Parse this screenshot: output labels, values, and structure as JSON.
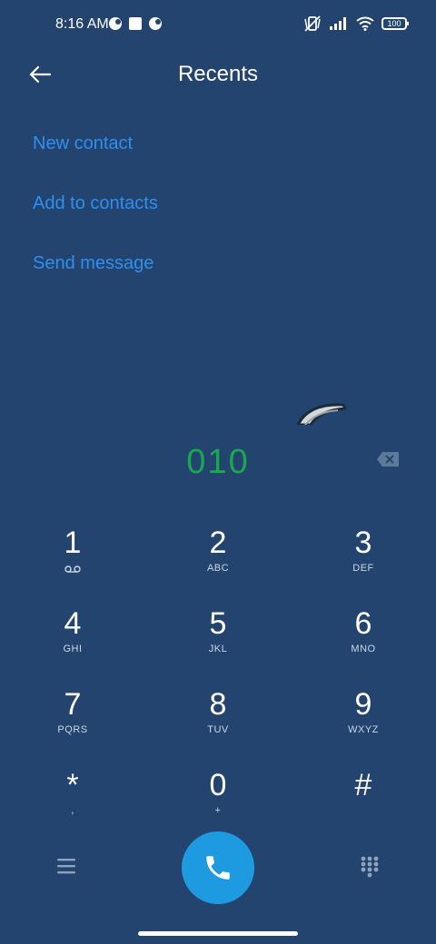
{
  "status_bar": {
    "time": "8:16 AM",
    "battery": "100"
  },
  "header": {
    "title": "Recents",
    "back_icon": "arrow-left-icon"
  },
  "actions": [
    {
      "label": "New contact"
    },
    {
      "label": "Add to contacts"
    },
    {
      "label": "Send message"
    }
  ],
  "dialer": {
    "number": "010",
    "number_color": "#18a84e"
  },
  "keypad": [
    {
      "digit": "1",
      "letters": ""
    },
    {
      "digit": "2",
      "letters": "ABC"
    },
    {
      "digit": "3",
      "letters": "DEF"
    },
    {
      "digit": "4",
      "letters": "GHI"
    },
    {
      "digit": "5",
      "letters": "JKL"
    },
    {
      "digit": "6",
      "letters": "MNO"
    },
    {
      "digit": "7",
      "letters": "PQRS"
    },
    {
      "digit": "8",
      "letters": "TUV"
    },
    {
      "digit": "9",
      "letters": "WXYZ"
    },
    {
      "digit": "*",
      "letters": ","
    },
    {
      "digit": "0",
      "letters": "+"
    },
    {
      "digit": "#",
      "letters": ""
    }
  ],
  "colors": {
    "background": "#23446e",
    "accent_link": "#2f8ff0",
    "call_button": "#1e9ae0"
  }
}
